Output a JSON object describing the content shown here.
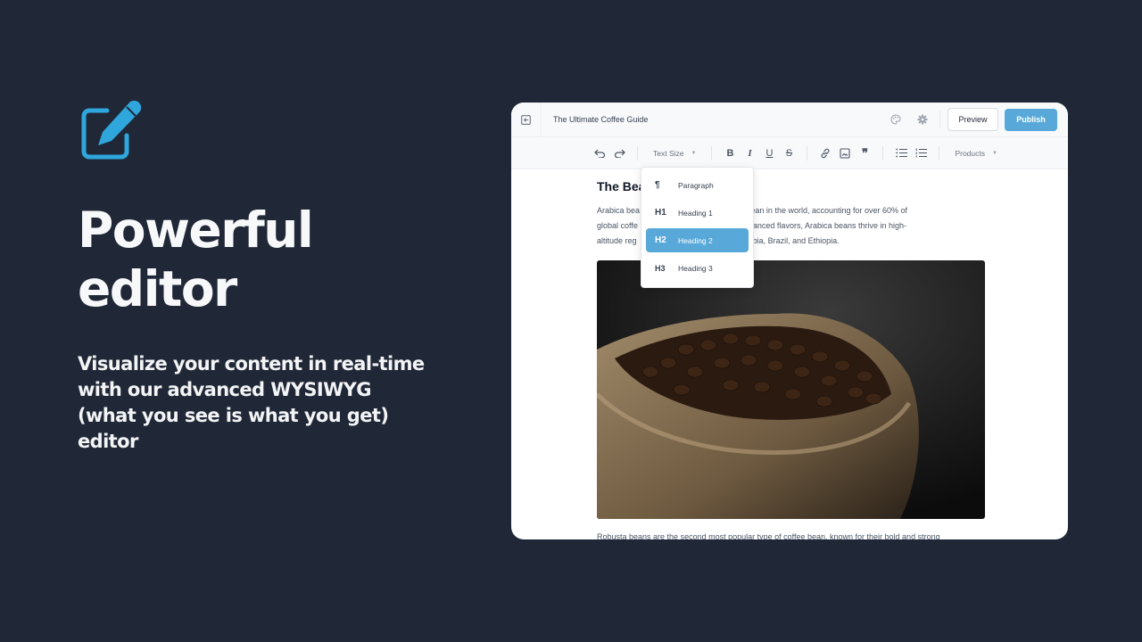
{
  "hero": {
    "icon": "edit-square-pencil-icon",
    "accent_color": "#2fa6dc",
    "title_line1": "Powerful",
    "title_line2": "editor",
    "subtitle": "Visualize your content in real-time with our advanced WYSIWYG (what you see is what you get) editor"
  },
  "editor": {
    "topbar": {
      "back_icon": "collapse-sidebar-icon",
      "document_title": "The Ultimate Coffee Guide",
      "palette_icon": "palette-icon",
      "settings_icon": "gear-icon",
      "preview_label": "Preview",
      "publish_label": "Publish",
      "publish_color": "#58a9da"
    },
    "toolbar": {
      "undo_icon": "undo-icon",
      "redo_icon": "redo-icon",
      "text_size_label": "Text Size",
      "bold_label": "B",
      "italic_label": "I",
      "underline_label": "U",
      "strike_label": "S",
      "link_icon": "link-icon",
      "image_icon": "image-icon",
      "quote_label": "❞",
      "bullet_list_icon": "bullet-list-icon",
      "numbered_list_icon": "numbered-list-icon",
      "products_label": "Products"
    },
    "text_size_menu": {
      "items": [
        {
          "symbol": "¶",
          "label": "Paragraph",
          "active": false
        },
        {
          "symbol": "H1",
          "label": "Heading 1",
          "active": false
        },
        {
          "symbol": "H2",
          "label": "Heading 2",
          "active": true
        },
        {
          "symbol": "H3",
          "label": "Heading 3",
          "active": false
        }
      ]
    },
    "content": {
      "heading_visible": "The Bea",
      "paragraph_lines": [
        "Arabica bea                              e of coffee bean in the world, accounting for over 60% of",
        "global coffe                              ir mild and nuanced flavors, Arabica beans thrive in high-",
        "altitude reg                              uch as Colombia, Brazil, and Ethiopia."
      ],
      "image_alt": "Burlap sack filled with roasted coffee beans",
      "paragraph2": "Robusta beans are the second most popular type of coffee bean, known for their bold and strong"
    }
  }
}
